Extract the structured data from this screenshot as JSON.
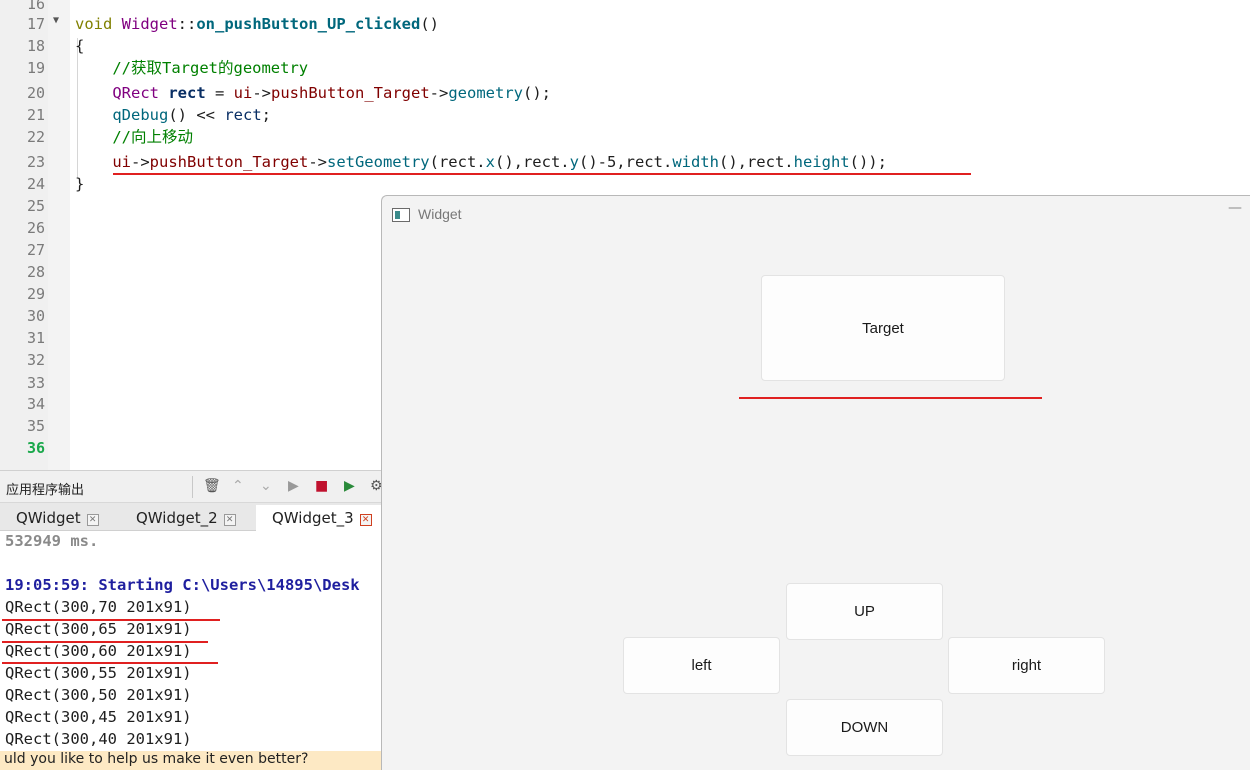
{
  "editor": {
    "line_numbers": [
      "16",
      "17",
      "18",
      "19",
      "20",
      "21",
      "22",
      "23",
      "24",
      "25",
      "26",
      "27",
      "28",
      "29",
      "30",
      "31",
      "32",
      "33",
      "34",
      "35",
      "36"
    ],
    "current_line": "36",
    "code": {
      "l17_void": "void",
      "l17_class": "Widget",
      "l17_sep": "::",
      "l17_fn": "on_pushButton_UP_clicked",
      "l17_paren": "()",
      "l18": "{",
      "l19_comment": "//获取Target的geometry",
      "l20_type": "QRect",
      "l20_var": "rect",
      "l20_eq": " = ",
      "l20_ui": "ui",
      "l20_arrow": "->",
      "l20_member": "pushButton_Target",
      "l20_arrow2": "->",
      "l20_call": "geometry",
      "l20_end": "();",
      "l21_call": "qDebug",
      "l21_mid": "() << ",
      "l21_var": "rect",
      "l21_end": ";",
      "l22_comment": "//向上移动",
      "l23_ui": "ui",
      "l23_arrow": "->",
      "l23_member": "pushButton_Target",
      "l23_arrow2": "->",
      "l23_call": "setGeometry",
      "l23_args_a": "(rect.",
      "l23_x": "x",
      "l23_args_b": "(),rect.",
      "l23_y": "y",
      "l23_args_c": "()-5,rect.",
      "l23_w": "width",
      "l23_args_d": "(),rect.",
      "l23_h": "height",
      "l23_args_e": "());",
      "l24": "}"
    }
  },
  "output": {
    "title": "应用程序输出",
    "tabs": [
      {
        "label": "QWidget",
        "active": false
      },
      {
        "label": "QWidget_2",
        "active": false
      },
      {
        "label": "QWidget_3",
        "active": true
      }
    ],
    "lines": [
      "532949 ms.",
      "",
      "19:05:59: Starting C:\\Users\\14895\\Desk",
      "QRect(300,70 201x91)",
      "QRect(300,65 201x91)",
      "QRect(300,60 201x91)",
      "QRect(300,55 201x91)",
      "QRect(300,50 201x91)",
      "QRect(300,45 201x91)",
      "QRect(300,40 201x91)"
    ],
    "feedback": "uld you like to help us make it even better?"
  },
  "window": {
    "title": "Widget",
    "minimize_glyph": "—",
    "buttons": {
      "target": "Target",
      "up": "UP",
      "left": "left",
      "right": "right",
      "down": "DOWN"
    }
  },
  "icons": {
    "fold": "▼",
    "trash": "🗑",
    "up": "⌃",
    "down": "⌄",
    "run": "▶",
    "stop": "■",
    "debug": "▶",
    "settings": "⚙",
    "close_tab": "✕"
  },
  "colors": {
    "annotation_red": "#e02020",
    "current_line_number": "#1aa84b"
  }
}
